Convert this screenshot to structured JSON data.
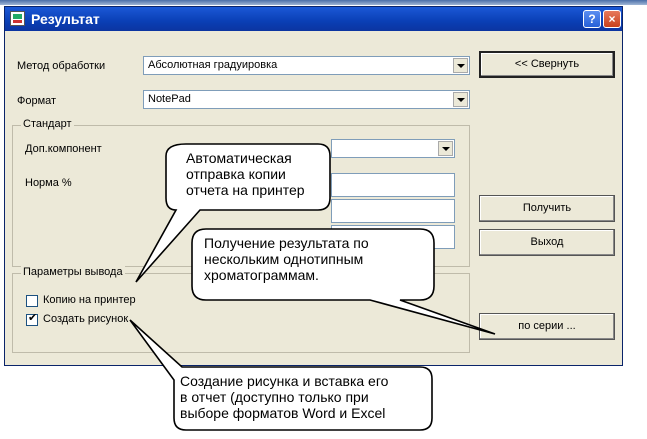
{
  "window": {
    "title": "Результат",
    "help_label": "?",
    "close_label": "×"
  },
  "form": {
    "method_label": "Метод обработки",
    "method_value": "Абсолютная градуировка",
    "format_label": "Формат",
    "format_value": "NotePad",
    "standard_group": "Стандарт",
    "component_label": "Доп.компонент",
    "norm_label": "Норма %",
    "output_group": "Параметры вывода",
    "copy_printer_label": "Копию на принтер",
    "create_picture_label": "Создать рисунок",
    "copy_printer_checked": false,
    "create_picture_checked": true
  },
  "buttons": {
    "collapse": "<< Свернуть",
    "get": "Получить",
    "exit": "Выход",
    "series": "по серии ..."
  },
  "callouts": {
    "printer_lines": [
      "Автоматическая",
      "отправка копии",
      "отчета на принтер"
    ],
    "series_lines": [
      "Получение результата по",
      "нескольким однотипным",
      "хроматограммам."
    ],
    "picture_lines": [
      "Создание рисунка и вставка его",
      "в отчет (доступно только при",
      "выборе форматов Word и Excel"
    ]
  }
}
